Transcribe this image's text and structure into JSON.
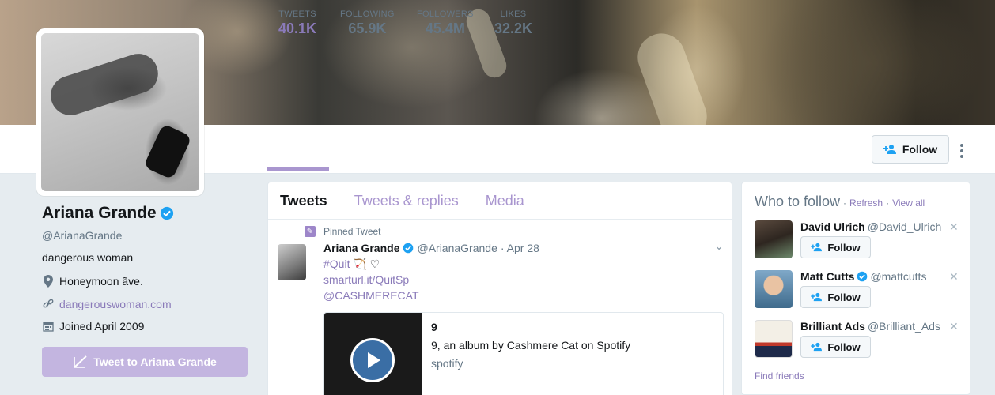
{
  "profile": {
    "name": "Ariana Grande",
    "handle": "@ArianaGrande",
    "bio": "dangerous woman",
    "location": "Honeymoon ãve.",
    "website": "dangerouswoman.com",
    "joined": "Joined April 2009",
    "tweet_to_label": "Tweet to Ariana Grande"
  },
  "stats": [
    {
      "label": "TWEETS",
      "value": "40.1K"
    },
    {
      "label": "FOLLOWING",
      "value": "65.9K"
    },
    {
      "label": "FOLLOWERS",
      "value": "45.4M"
    },
    {
      "label": "LIKES",
      "value": "32.2K"
    }
  ],
  "header": {
    "follow_label": "Follow"
  },
  "timeline": {
    "tabs": [
      "Tweets",
      "Tweets & replies",
      "Media"
    ],
    "pinned_label": "Pinned Tweet",
    "tweet": {
      "name": "Ariana Grande",
      "handle": "@ArianaGrande",
      "date": "· Apr 28",
      "hashtag": "#Quit",
      "emoji": "🏹 ♡",
      "link": "smarturl.it/QuitSp",
      "mention": "@CASHMERECAT",
      "card": {
        "title": "9",
        "description": "9, an album by Cashmere Cat on Spotify",
        "domain": "spotify"
      }
    }
  },
  "who_to_follow": {
    "title": "Who to follow",
    "dot": "·",
    "refresh": "Refresh",
    "view_all": "View all",
    "follow_label": "Follow",
    "find_friends": "Find friends",
    "suggestions": [
      {
        "name": "David Ulrich",
        "handle": "@David_Ulrich"
      },
      {
        "name": "Matt Cutts",
        "handle": "@mattcutts"
      },
      {
        "name": "Brilliant Ads",
        "handle": "@Brilliant_Ads"
      }
    ]
  },
  "colors": {
    "accent": "#8a7ab9",
    "verified": "#1da1f2"
  }
}
